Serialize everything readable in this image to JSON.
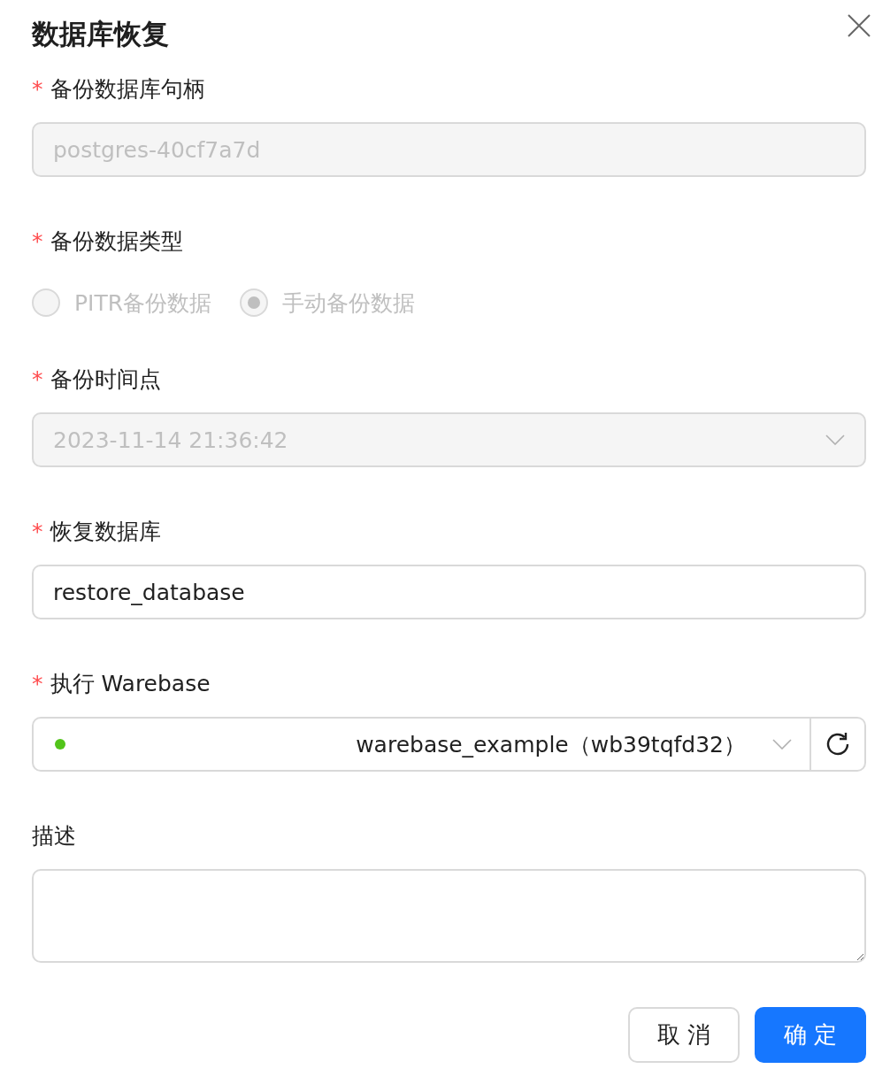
{
  "dialog": {
    "title": "数据库恢复"
  },
  "fields": [
    {
      "kind": "input",
      "label": "备份数据库句柄",
      "required_mark": "*",
      "value": "postgres-40cf7a7d",
      "disabled": true
    },
    {
      "kind": "radio",
      "label": "备份数据类型",
      "required_mark": "*",
      "disabled": true,
      "options": [
        {
          "label": "PITR备份数据",
          "selected": false
        },
        {
          "label": "手动备份数据",
          "selected": true
        }
      ]
    },
    {
      "kind": "select",
      "label": "备份时间点",
      "required_mark": "*",
      "value": "2023-11-14 21:36:42",
      "disabled": true
    },
    {
      "kind": "input",
      "label": "恢复数据库",
      "required_mark": "*",
      "value": "restore_database",
      "disabled": false
    },
    {
      "kind": "instance",
      "label": "执行 Warebase",
      "required_mark": "*",
      "value": "warebase_example（wb39tqfd32）",
      "color": "#52c41a"
    },
    {
      "kind": "textarea",
      "label": "描述"
    }
  ],
  "buttons": [
    {
      "label": "取 消",
      "kind": "default"
    },
    {
      "label": "确 定",
      "kind": "primary"
    }
  ]
}
